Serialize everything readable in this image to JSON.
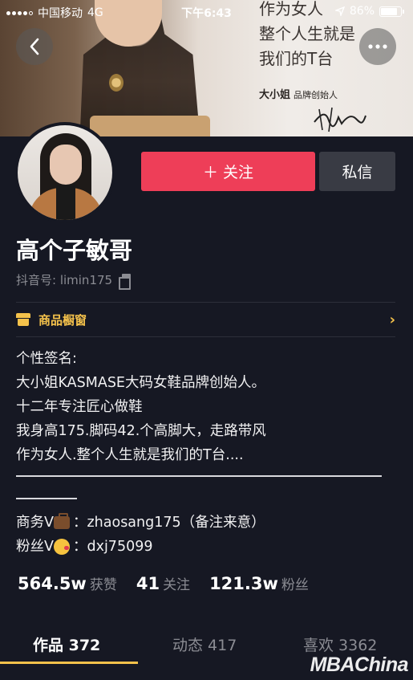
{
  "status_bar": {
    "carrier": "中国移动",
    "network": "4G",
    "time": "下午6:43",
    "battery": "86%",
    "battery_level": 0.86
  },
  "banner": {
    "text_lines": [
      "作为女人",
      "整个人生就是",
      "我们的T台"
    ],
    "brand_name": "大小姐",
    "brand_title": "品牌创始人"
  },
  "header": {
    "back_icon": "back-arrow-icon",
    "more_icon": "more-dots-icon"
  },
  "actions": {
    "follow_label": "＋ 关注",
    "message_label": "私信"
  },
  "profile": {
    "nickname": "高个子敏哥",
    "douyin_id": "抖音号: limin175"
  },
  "shop": {
    "label": "商品橱窗",
    "chevron": "›"
  },
  "bio": {
    "lines": [
      "个性签名:",
      "大小姐KASMASE大码女鞋品牌创始人。",
      "十二年专注匠心做鞋",
      "我身高175.脚码42.个高脚大，走路带风",
      "作为女人.整个人生就是我们的T台...."
    ]
  },
  "contact": {
    "business_label": "商务V",
    "business_value": "：zhaosang175（备注来意）",
    "fans_label": "粉丝V",
    "fans_value": "：dxj75099"
  },
  "stats": [
    {
      "num": "564.5w",
      "label": "获赞"
    },
    {
      "num": "41",
      "label": "关注"
    },
    {
      "num": "121.3w",
      "label": "粉丝"
    }
  ],
  "tabs": [
    {
      "label": "作品 372"
    },
    {
      "label": "动态 417"
    },
    {
      "label": "喜欢 3362"
    }
  ],
  "watermark": "MBAChina",
  "colors": {
    "background": "#161823",
    "follow": "#ee3e58",
    "accent": "#f5c24b",
    "muted": "#8b8c93"
  }
}
